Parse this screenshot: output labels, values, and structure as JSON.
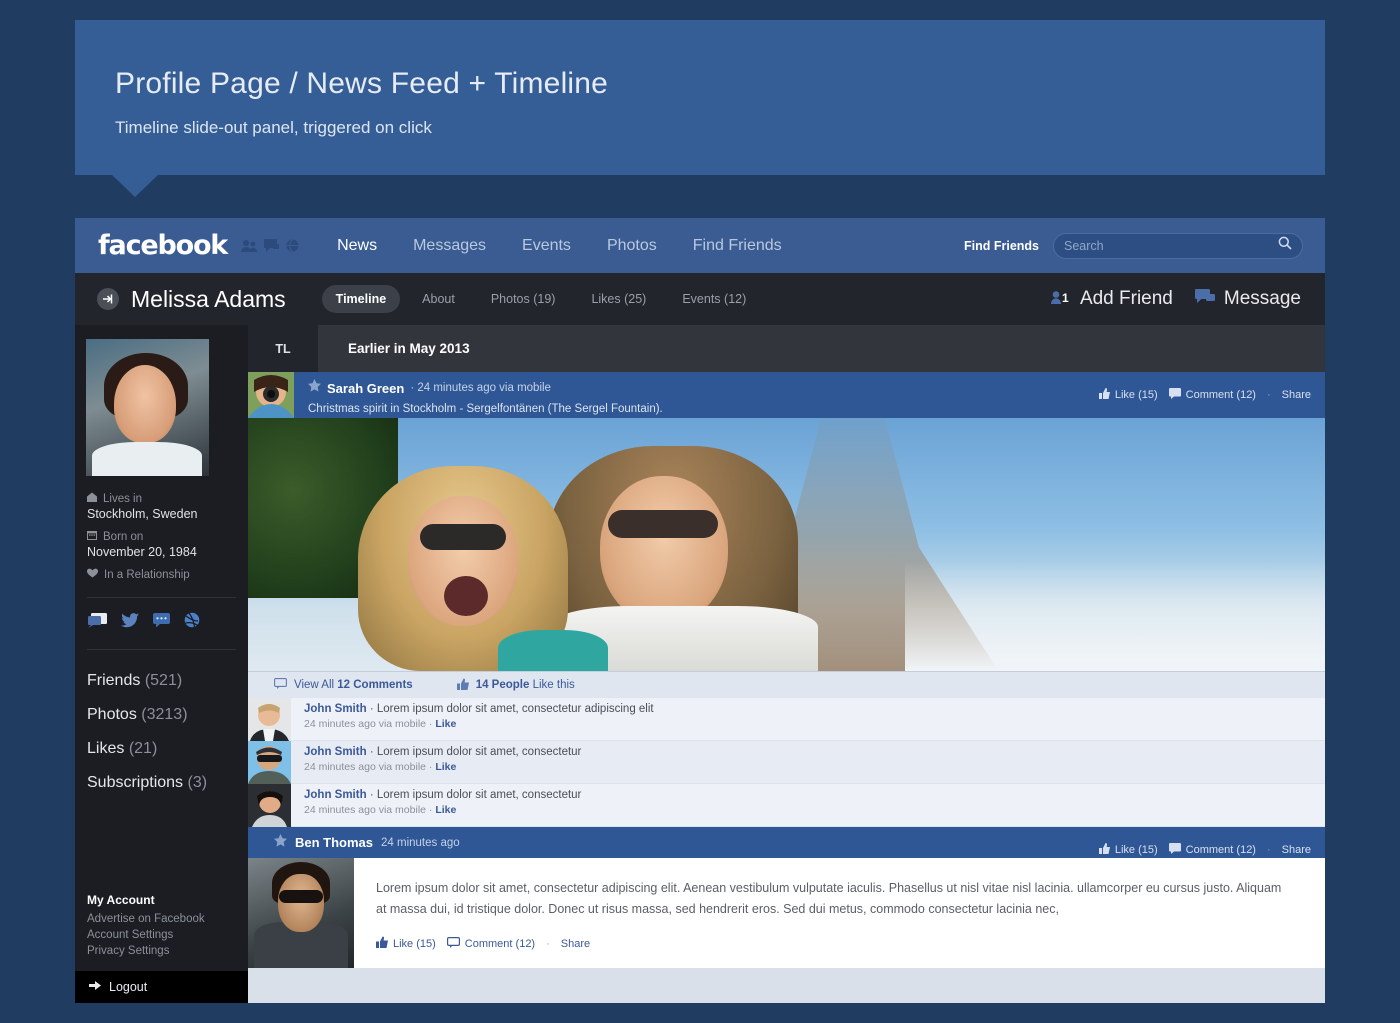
{
  "callout": {
    "title": "Profile Page / News Feed + Timeline",
    "subtitle": "Timeline slide-out panel, triggered on click"
  },
  "topnav": {
    "logo": "facebook",
    "icons": [
      "friends-icon",
      "messages-icon",
      "globe-icon"
    ],
    "links": [
      {
        "label": "News",
        "active": true
      },
      {
        "label": "Messages",
        "active": false
      },
      {
        "label": "Events",
        "active": false
      },
      {
        "label": "Photos",
        "active": false
      },
      {
        "label": "Find Friends",
        "active": false
      }
    ],
    "find_friends": "Find Friends",
    "search_placeholder": "Search",
    "search_value": ""
  },
  "profilebar": {
    "name": "Melissa Adams",
    "tabs": [
      {
        "label": "Timeline",
        "active": true
      },
      {
        "label": "About",
        "active": false
      },
      {
        "label": "Photos (19)",
        "active": false
      },
      {
        "label": "Likes (25)",
        "active": false
      },
      {
        "label": "Events (12)",
        "active": false
      }
    ],
    "add_friend": "Add Friend",
    "message": "Message"
  },
  "sidebar": {
    "info": [
      {
        "icon": "home-icon",
        "label": "Lives in",
        "value": "Stockholm, Sweden"
      },
      {
        "icon": "calendar-icon",
        "label": "Born on",
        "value": "November 20, 1984"
      },
      {
        "icon": "heart-icon",
        "label": "In a Relationship",
        "value": ""
      }
    ],
    "social_icons": [
      "message-icon",
      "twitter-icon",
      "comment-icon",
      "dribbble-icon"
    ],
    "links": [
      {
        "label": "Friends",
        "count": "(521)"
      },
      {
        "label": "Photos",
        "count": "(3213)"
      },
      {
        "label": "Likes",
        "count": "(21)"
      },
      {
        "label": "Subscriptions",
        "count": "(3)"
      }
    ],
    "account_title": "My Account",
    "account_links": [
      "Advertise on Facebook",
      "Account Settings",
      "Privacy Settings"
    ],
    "logout": "Logout"
  },
  "timeline": {
    "tab": "TL",
    "title": "Earlier in May 2013"
  },
  "post1": {
    "author": "Sarah Green",
    "meta": "· 24 minutes ago via mobile",
    "caption": "Christmas spirit in Stockholm - Sergelfontänen (The Sergel Fountain).",
    "like": "Like (15)",
    "comment": "Comment (12)",
    "share": "Share",
    "view_comments_pre": "View All ",
    "view_comments_bold": "12 Comments",
    "people_like_bold": "14 People",
    "people_like_post": " Like this",
    "comments": [
      {
        "name": "John Smith",
        "text": "· Lorem ipsum dolor sit amet, consectetur adipiscing elit",
        "meta": "24 minutes ago via mobile ·",
        "like": "Like"
      },
      {
        "name": "John Smith",
        "text": "· Lorem ipsum dolor sit amet, consectetur",
        "meta": "24 minutes ago via mobile ·",
        "like": "Like"
      },
      {
        "name": "John Smith",
        "text": "· Lorem ipsum dolor sit amet, consectetur",
        "meta": "24 minutes ago via mobile ·",
        "like": "Like"
      }
    ]
  },
  "post2": {
    "author": "Ben Thomas",
    "meta": "24 minutes ago",
    "like": "Like (15)",
    "comment": "Comment (12)",
    "share": "Share",
    "body": "Lorem ipsum dolor sit amet, consectetur adipiscing elit. Aenean vestibulum vulputate iaculis. Phasellus ut nisl vitae nisl lacinia. ullamcorper eu cursus justo. Aliquam at massa dui, id tristique dolor. Donec ut risus massa, sed hendrerit eros. Sed dui metus, commodo consectetur lacinia nec,"
  },
  "colors": {
    "page_bg": "#213c61",
    "callout_bg": "#355e96",
    "nav_blue": "#3a5c92",
    "dark_bar": "#22252b",
    "sidebar": "#1b1d22",
    "post_blue": "#2f5695",
    "link_blue": "#3b5998"
  }
}
